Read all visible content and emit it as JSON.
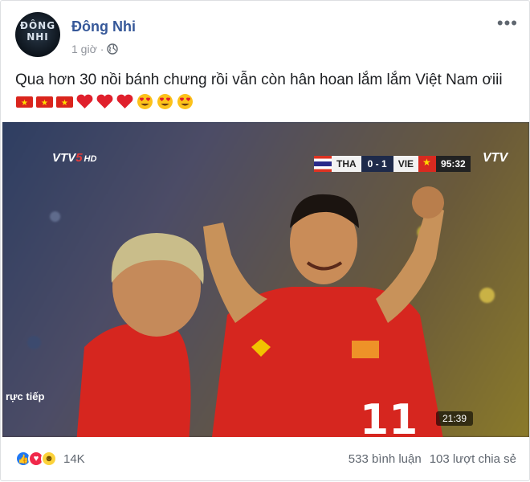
{
  "post": {
    "author": "Đông Nhi",
    "avatar_text": "ĐÔNG NHI",
    "time": "1 giờ",
    "privacy_icon": "globe-icon",
    "more_icon": "more-icon",
    "caption": "Qua hơn 30 nồi bánh chưng rồi vẫn còn hân hoan lắm lắm Việt Nam ơiii",
    "emojis": [
      "vn-flag-icon",
      "vn-flag-icon",
      "vn-flag-icon",
      "red-heart-icon",
      "red-heart-icon",
      "red-heart-icon",
      "heart-eyes-icon",
      "heart-eyes-icon",
      "heart-eyes-icon"
    ]
  },
  "video": {
    "channel_logo": "VTV",
    "channel_number": "5",
    "hd_label": "HD",
    "team_home": "THA",
    "score": "0 - 1",
    "team_away": "VIE",
    "match_clock": "95:32",
    "corner_logo": "VTV",
    "live_label": "rực tiếp",
    "jersey_number": "11",
    "timestamp": "21:39"
  },
  "footer": {
    "reaction_count": "14K",
    "comments": "533 bình luận",
    "shares": "103 lượt chia sẻ"
  },
  "colors": {
    "link": "#365899",
    "muted": "#90949c",
    "like": "#2078f4",
    "love": "#f0284a",
    "jersey": "#d6261f"
  }
}
